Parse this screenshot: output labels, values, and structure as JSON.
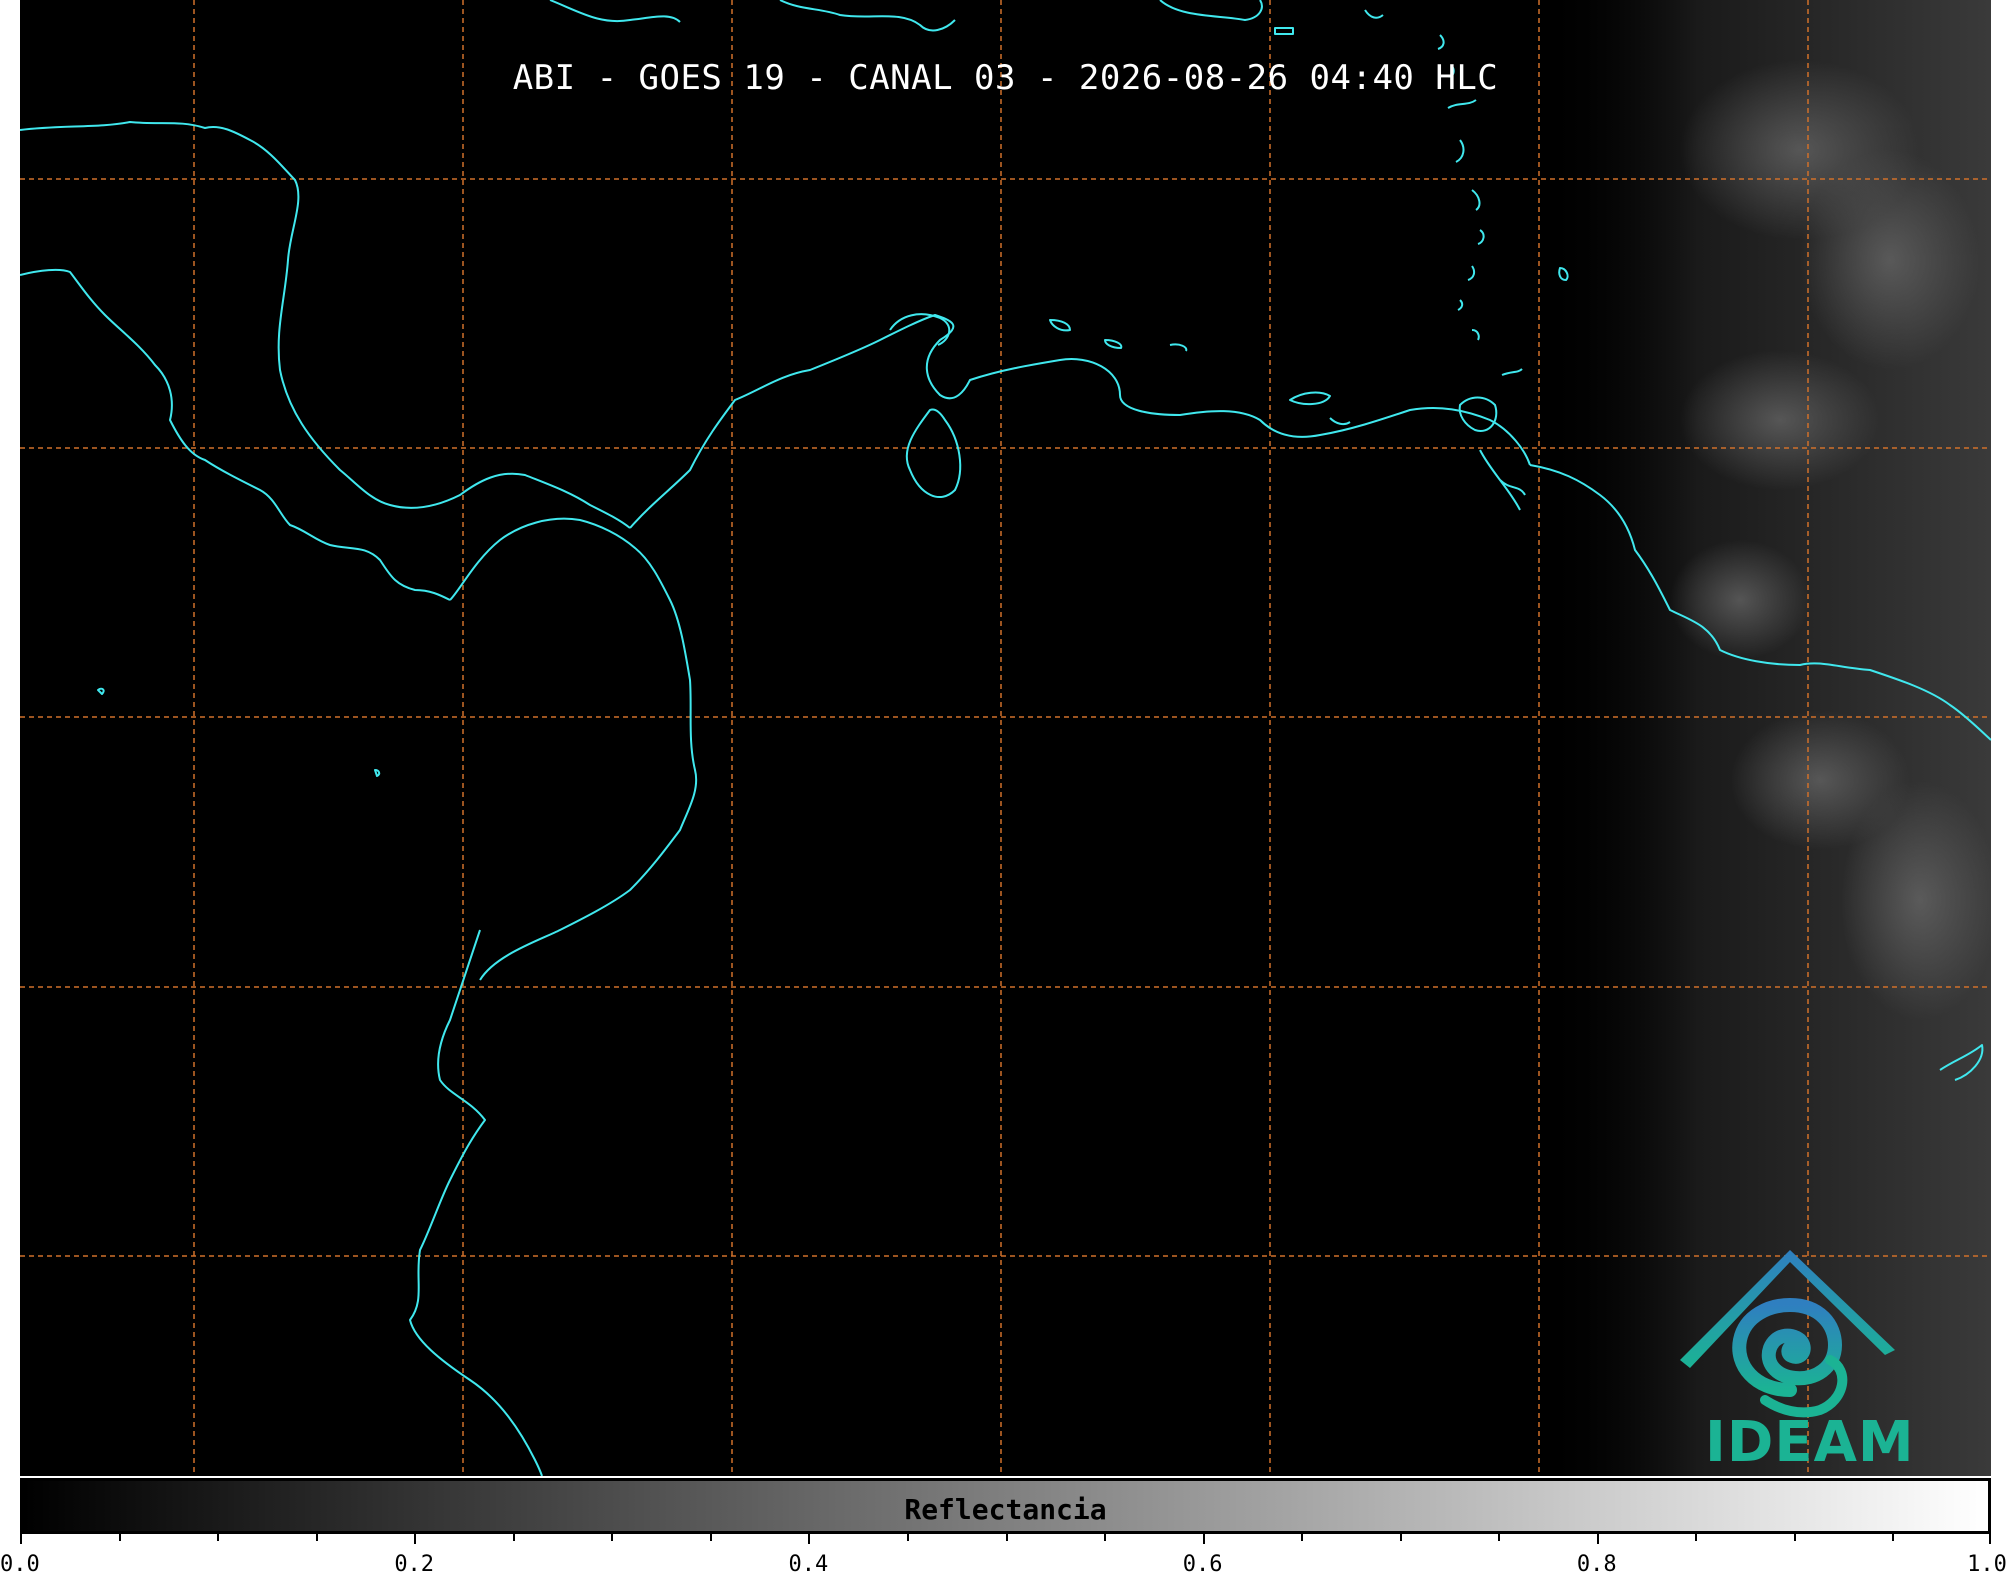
{
  "map": {
    "title": "ABI - GOES 19 - CANAL 03 - 2026-08-26 04:40 HLC",
    "background_color": "#000000",
    "coastline_color": "#40e8ee",
    "gridline_color": "#d0702a",
    "gridlines": "dashed"
  },
  "logo": {
    "text": "IDEAM",
    "icon": "ideam-mountain-spiral-logo",
    "color_top": "#2f7fc0",
    "color_bottom": "#1bb394"
  },
  "colorbar": {
    "label": "Reflectancia",
    "min": 0.0,
    "max": 1.0,
    "gradient_start": "#000000",
    "gradient_end": "#ffffff",
    "tick_labels": [
      "0.0",
      "0.2",
      "0.4",
      "0.6",
      "0.8",
      "1.0"
    ],
    "tick_values": [
      0.0,
      0.2,
      0.4,
      0.6,
      0.8,
      1.0
    ]
  }
}
